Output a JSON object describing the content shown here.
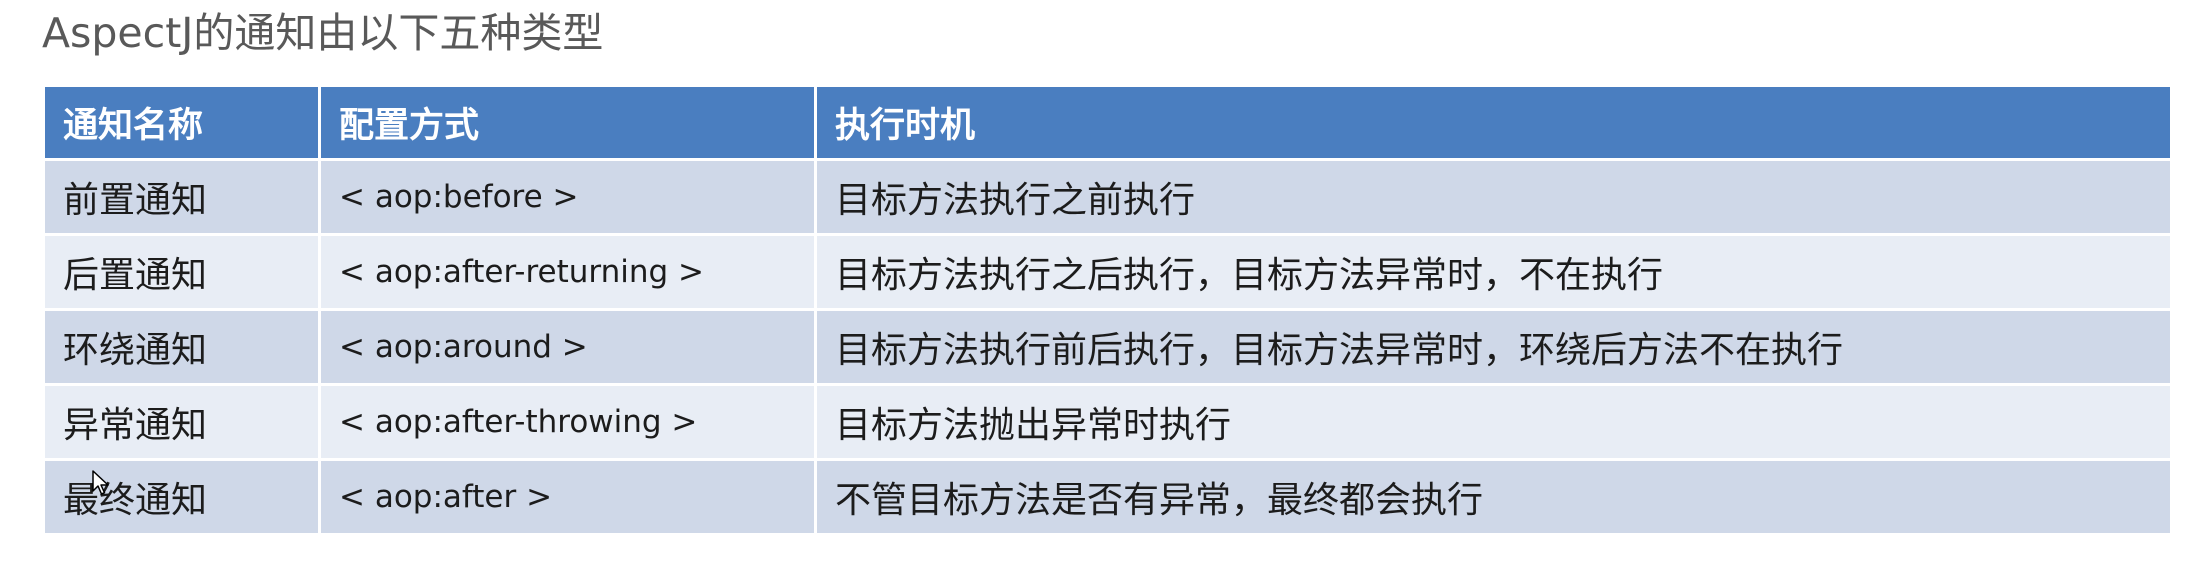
{
  "title": "AspectJ的通知由以下五种类型",
  "table": {
    "headers": [
      "通知名称",
      "配置方式",
      "执行时机"
    ],
    "rows": [
      {
        "name": "前置通知",
        "config": "< aop:before >",
        "timing": "目标方法执行之前执行"
      },
      {
        "name": "后置通知",
        "config": "< aop:after-returning >",
        "timing": "目标方法执行之后执行，目标方法异常时，不在执行"
      },
      {
        "name": "环绕通知",
        "config": "< aop:around >",
        "timing": "目标方法执行前后执行，目标方法异常时，环绕后方法不在执行"
      },
      {
        "name": "异常通知",
        "config": "< aop:after-throwing >",
        "timing": "目标方法抛出异常时执行"
      },
      {
        "name": "最终通知",
        "config": "< aop:after >",
        "timing": "不管目标方法是否有异常，最终都会执行"
      }
    ]
  },
  "colors": {
    "header_bg": "#4a7ec0",
    "row_dark": "#cfd8e8",
    "row_light": "#e8edf5",
    "title_text": "#595959"
  },
  "cursor": {
    "icon": "mouse-pointer-icon"
  }
}
